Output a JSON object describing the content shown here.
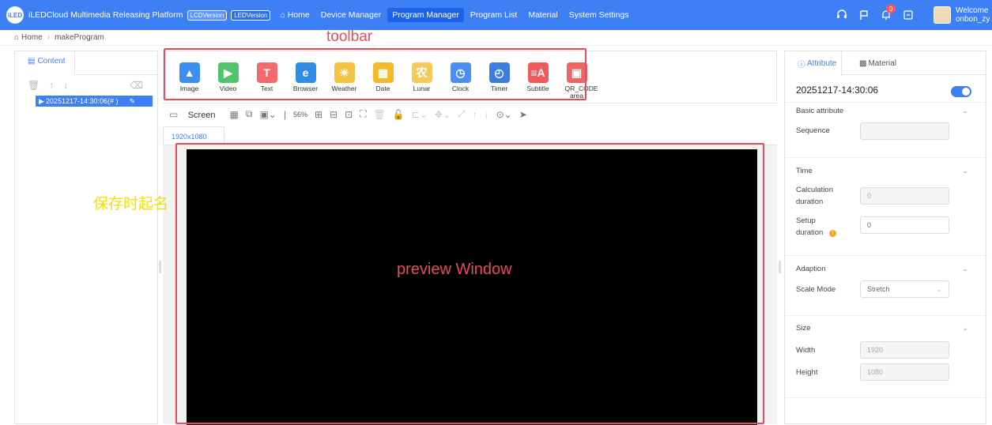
{
  "header": {
    "logo_text": "iLED",
    "app_title": "iLEDCloud Multimedia Releasing Platform",
    "version_buttons": [
      "LCDVersion",
      "LEDVersion"
    ],
    "nav": [
      "Home",
      "Device Manager",
      "Program Manager",
      "Program List",
      "Material",
      "System Settings"
    ],
    "active_nav": "Program Manager",
    "notification_count": "0",
    "welcome": "Welcome",
    "username": "onbon_zy"
  },
  "breadcrumb": {
    "home": "Home",
    "current": "makeProgram"
  },
  "left_panel": {
    "tab": "Content",
    "program_item": "20251217-14:30:06(# )"
  },
  "toolbar": {
    "tools": [
      {
        "label": "Image",
        "icon": "image-icon",
        "color": "#3d8ef0"
      },
      {
        "label": "Video",
        "icon": "video-icon",
        "color": "#52c46b"
      },
      {
        "label": "Text",
        "icon": "text-icon",
        "color": "#f26a6a"
      },
      {
        "label": "Browser",
        "icon": "browser-icon",
        "color": "#2f8de4"
      },
      {
        "label": "Weather",
        "icon": "weather-icon",
        "color": "#f5c342"
      },
      {
        "label": "Date",
        "icon": "date-icon",
        "color": "#f5b82e"
      },
      {
        "label": "Lunar",
        "icon": "lunar-icon",
        "color": "#f5c95a"
      },
      {
        "label": "Clock",
        "icon": "clock-icon",
        "color": "#4a8ef0"
      },
      {
        "label": "Timer",
        "icon": "timer-icon",
        "color": "#3c7de0"
      },
      {
        "label": "Subtitle",
        "icon": "subtitle-icon",
        "color": "#f05a5a"
      },
      {
        "label": "QR_CODE area",
        "icon": "qrcode-icon",
        "color": "#f06464"
      }
    ]
  },
  "edit_toolbar": {
    "screen_label": "Screen",
    "zoom": "56%"
  },
  "resolution_tab": "1920x1080",
  "annotations": {
    "toolbar": "toolbar",
    "preview": "preview Window",
    "save_note": "保存时起名"
  },
  "right_panel": {
    "tab_attribute": "Attribute",
    "tab_material": "Material",
    "program_name": "20251217-14:30:06",
    "basic_attribute": "Basic attribute",
    "sequence_label": "Sequence",
    "time_section": "Time",
    "calc_duration_label": "Calculation duration",
    "calc_duration_value": "0",
    "setup_duration_label": "Setup duration",
    "setup_duration_value": "0",
    "adaption_section": "Adaption",
    "scale_mode_label": "Scale Mode",
    "scale_mode_value": "Stretch",
    "size_section": "Size",
    "width_label": "Width",
    "width_value": "1920",
    "height_label": "Height",
    "height_value": "1080"
  },
  "colors": {
    "primary": "#3d7ff5",
    "annotation": "#e74c5e",
    "note": "#f5e000"
  }
}
